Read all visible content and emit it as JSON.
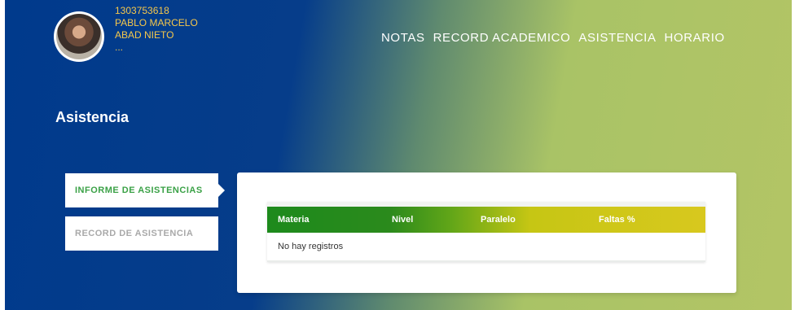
{
  "user": {
    "id": "1303753618",
    "name_line1": "PABLO MARCELO",
    "name_line2": "ABAD NIETO",
    "extra": "..."
  },
  "nav": {
    "items": [
      "NOTAS",
      "RECORD ACADEMICO",
      "ASISTENCIA",
      "HORARIO"
    ]
  },
  "page": {
    "title": "Asistencia"
  },
  "tabs": {
    "active_label": "INFORME DE ASISTENCIAS",
    "inactive_label": "RECORD DE ASISTENCIA"
  },
  "table": {
    "columns": [
      "Materia",
      "Nivel",
      "Paralelo",
      "Faltas %"
    ],
    "empty_message": "No hay registros"
  },
  "colors": {
    "accent_green": "#3aa146",
    "user_text": "#f6c84b",
    "nav_text": "#ffffff"
  }
}
